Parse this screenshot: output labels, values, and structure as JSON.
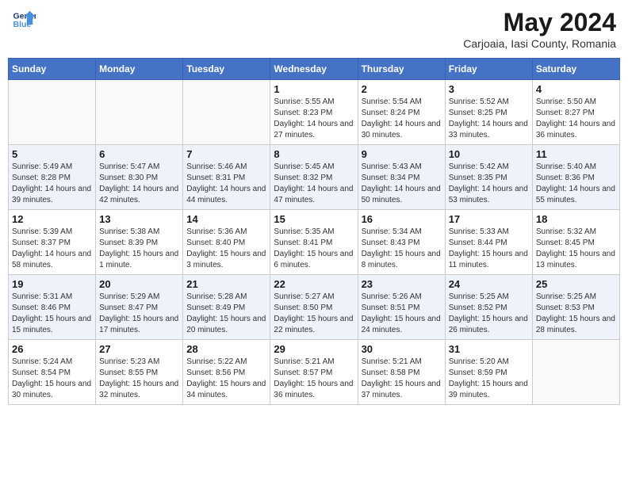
{
  "logo": {
    "line1": "General",
    "line2": "Blue"
  },
  "title": "May 2024",
  "subtitle": "Carjoaia, Iasi County, Romania",
  "weekdays": [
    "Sunday",
    "Monday",
    "Tuesday",
    "Wednesday",
    "Thursday",
    "Friday",
    "Saturday"
  ],
  "weeks": [
    [
      {
        "day": "",
        "info": ""
      },
      {
        "day": "",
        "info": ""
      },
      {
        "day": "",
        "info": ""
      },
      {
        "day": "1",
        "info": "Sunrise: 5:55 AM\nSunset: 8:23 PM\nDaylight: 14 hours and 27 minutes."
      },
      {
        "day": "2",
        "info": "Sunrise: 5:54 AM\nSunset: 8:24 PM\nDaylight: 14 hours and 30 minutes."
      },
      {
        "day": "3",
        "info": "Sunrise: 5:52 AM\nSunset: 8:25 PM\nDaylight: 14 hours and 33 minutes."
      },
      {
        "day": "4",
        "info": "Sunrise: 5:50 AM\nSunset: 8:27 PM\nDaylight: 14 hours and 36 minutes."
      }
    ],
    [
      {
        "day": "5",
        "info": "Sunrise: 5:49 AM\nSunset: 8:28 PM\nDaylight: 14 hours and 39 minutes."
      },
      {
        "day": "6",
        "info": "Sunrise: 5:47 AM\nSunset: 8:30 PM\nDaylight: 14 hours and 42 minutes."
      },
      {
        "day": "7",
        "info": "Sunrise: 5:46 AM\nSunset: 8:31 PM\nDaylight: 14 hours and 44 minutes."
      },
      {
        "day": "8",
        "info": "Sunrise: 5:45 AM\nSunset: 8:32 PM\nDaylight: 14 hours and 47 minutes."
      },
      {
        "day": "9",
        "info": "Sunrise: 5:43 AM\nSunset: 8:34 PM\nDaylight: 14 hours and 50 minutes."
      },
      {
        "day": "10",
        "info": "Sunrise: 5:42 AM\nSunset: 8:35 PM\nDaylight: 14 hours and 53 minutes."
      },
      {
        "day": "11",
        "info": "Sunrise: 5:40 AM\nSunset: 8:36 PM\nDaylight: 14 hours and 55 minutes."
      }
    ],
    [
      {
        "day": "12",
        "info": "Sunrise: 5:39 AM\nSunset: 8:37 PM\nDaylight: 14 hours and 58 minutes."
      },
      {
        "day": "13",
        "info": "Sunrise: 5:38 AM\nSunset: 8:39 PM\nDaylight: 15 hours and 1 minute."
      },
      {
        "day": "14",
        "info": "Sunrise: 5:36 AM\nSunset: 8:40 PM\nDaylight: 15 hours and 3 minutes."
      },
      {
        "day": "15",
        "info": "Sunrise: 5:35 AM\nSunset: 8:41 PM\nDaylight: 15 hours and 6 minutes."
      },
      {
        "day": "16",
        "info": "Sunrise: 5:34 AM\nSunset: 8:43 PM\nDaylight: 15 hours and 8 minutes."
      },
      {
        "day": "17",
        "info": "Sunrise: 5:33 AM\nSunset: 8:44 PM\nDaylight: 15 hours and 11 minutes."
      },
      {
        "day": "18",
        "info": "Sunrise: 5:32 AM\nSunset: 8:45 PM\nDaylight: 15 hours and 13 minutes."
      }
    ],
    [
      {
        "day": "19",
        "info": "Sunrise: 5:31 AM\nSunset: 8:46 PM\nDaylight: 15 hours and 15 minutes."
      },
      {
        "day": "20",
        "info": "Sunrise: 5:29 AM\nSunset: 8:47 PM\nDaylight: 15 hours and 17 minutes."
      },
      {
        "day": "21",
        "info": "Sunrise: 5:28 AM\nSunset: 8:49 PM\nDaylight: 15 hours and 20 minutes."
      },
      {
        "day": "22",
        "info": "Sunrise: 5:27 AM\nSunset: 8:50 PM\nDaylight: 15 hours and 22 minutes."
      },
      {
        "day": "23",
        "info": "Sunrise: 5:26 AM\nSunset: 8:51 PM\nDaylight: 15 hours and 24 minutes."
      },
      {
        "day": "24",
        "info": "Sunrise: 5:25 AM\nSunset: 8:52 PM\nDaylight: 15 hours and 26 minutes."
      },
      {
        "day": "25",
        "info": "Sunrise: 5:25 AM\nSunset: 8:53 PM\nDaylight: 15 hours and 28 minutes."
      }
    ],
    [
      {
        "day": "26",
        "info": "Sunrise: 5:24 AM\nSunset: 8:54 PM\nDaylight: 15 hours and 30 minutes."
      },
      {
        "day": "27",
        "info": "Sunrise: 5:23 AM\nSunset: 8:55 PM\nDaylight: 15 hours and 32 minutes."
      },
      {
        "day": "28",
        "info": "Sunrise: 5:22 AM\nSunset: 8:56 PM\nDaylight: 15 hours and 34 minutes."
      },
      {
        "day": "29",
        "info": "Sunrise: 5:21 AM\nSunset: 8:57 PM\nDaylight: 15 hours and 36 minutes."
      },
      {
        "day": "30",
        "info": "Sunrise: 5:21 AM\nSunset: 8:58 PM\nDaylight: 15 hours and 37 minutes."
      },
      {
        "day": "31",
        "info": "Sunrise: 5:20 AM\nSunset: 8:59 PM\nDaylight: 15 hours and 39 minutes."
      },
      {
        "day": "",
        "info": ""
      }
    ]
  ]
}
